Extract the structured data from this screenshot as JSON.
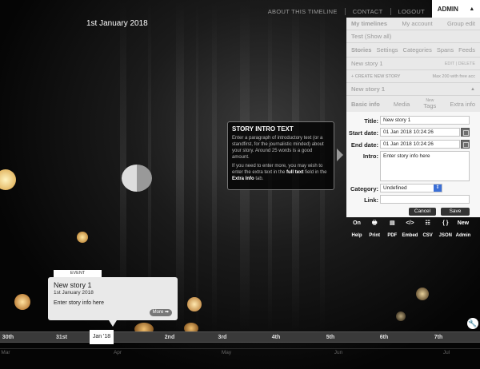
{
  "nav": {
    "links": [
      "ABOUT THIS TIMELINE",
      "CONTACT",
      "LOGOUT"
    ],
    "admin_label": "ADMIN",
    "admin_arrow": "▲"
  },
  "date_display": "1st January 2018",
  "panel": {
    "top_tabs": [
      "My timelines",
      "My account",
      "Group edit"
    ],
    "test_label": "Test",
    "test_show_all": "(Show all)",
    "section_tabs": [
      "Stories",
      "Settings",
      "Categories",
      "Spans",
      "Feeds"
    ],
    "story_list_item": "New story 1",
    "story_list_actions": "EDIT | DELETE",
    "create_label": "+ CREATE NEW STORY",
    "create_limit": "Max 200 with free acc",
    "current_story": "New story 1",
    "current_story_arrow": "▲",
    "story_tabs": [
      "Basic info",
      "Media",
      "Tags",
      "Extra info"
    ],
    "tags_super": "New",
    "form": {
      "title_label": "Title:",
      "title_value": "New story 1",
      "start_label": "Start date:",
      "start_value": "01 Jan 2018 10:24:26",
      "end_label": "End date:",
      "end_value": "01 Jan 2018 10:24:26",
      "intro_label": "Intro:",
      "intro_value": "Enter story info here",
      "category_label": "Category:",
      "category_value": "Undefined",
      "link_label": "Link:",
      "link_value": "",
      "cancel_label": "Cancel",
      "save_label": "Save"
    }
  },
  "toolbar": [
    {
      "icon": "On",
      "label": "Help"
    },
    {
      "icon": "🖶",
      "label": "Print"
    },
    {
      "icon": "▤",
      "label": "PDF"
    },
    {
      "icon": "</>",
      "label": "Embed"
    },
    {
      "icon": "☷",
      "label": "CSV"
    },
    {
      "icon": "{ }",
      "label": "JSON"
    },
    {
      "icon": "New",
      "label": "Admin"
    }
  ],
  "popup": {
    "heading": "STORY INTRO TEXT",
    "p1": "Enter a paragraph of introductory text (or a standfirst, for the journalistic minded) about your story. Around 25 words is a good amount.",
    "p2_a": "If you need to enter more, you may wish to enter the extra text in the ",
    "p2_b": "full text",
    "p2_c": " field in the ",
    "p2_d": "Extra Info",
    "p2_e": " tab."
  },
  "event": {
    "tag": "EVENT",
    "title": "New story 1",
    "date": "1st January 2018",
    "intro": "Enter story info here",
    "more_label": "More ➡"
  },
  "timeline": {
    "ticks": [
      "30th",
      "31st",
      "2nd",
      "3rd",
      "4th",
      "5th",
      "6th",
      "7th"
    ],
    "active_tick": "Jan '18",
    "months": [
      "Mar",
      "Apr",
      "May",
      "Jun",
      "Jul"
    ]
  },
  "colors": {
    "panel_bg": "#e9e9e9",
    "accent_select": "#3b6fd6",
    "button_dark": "#333333"
  }
}
